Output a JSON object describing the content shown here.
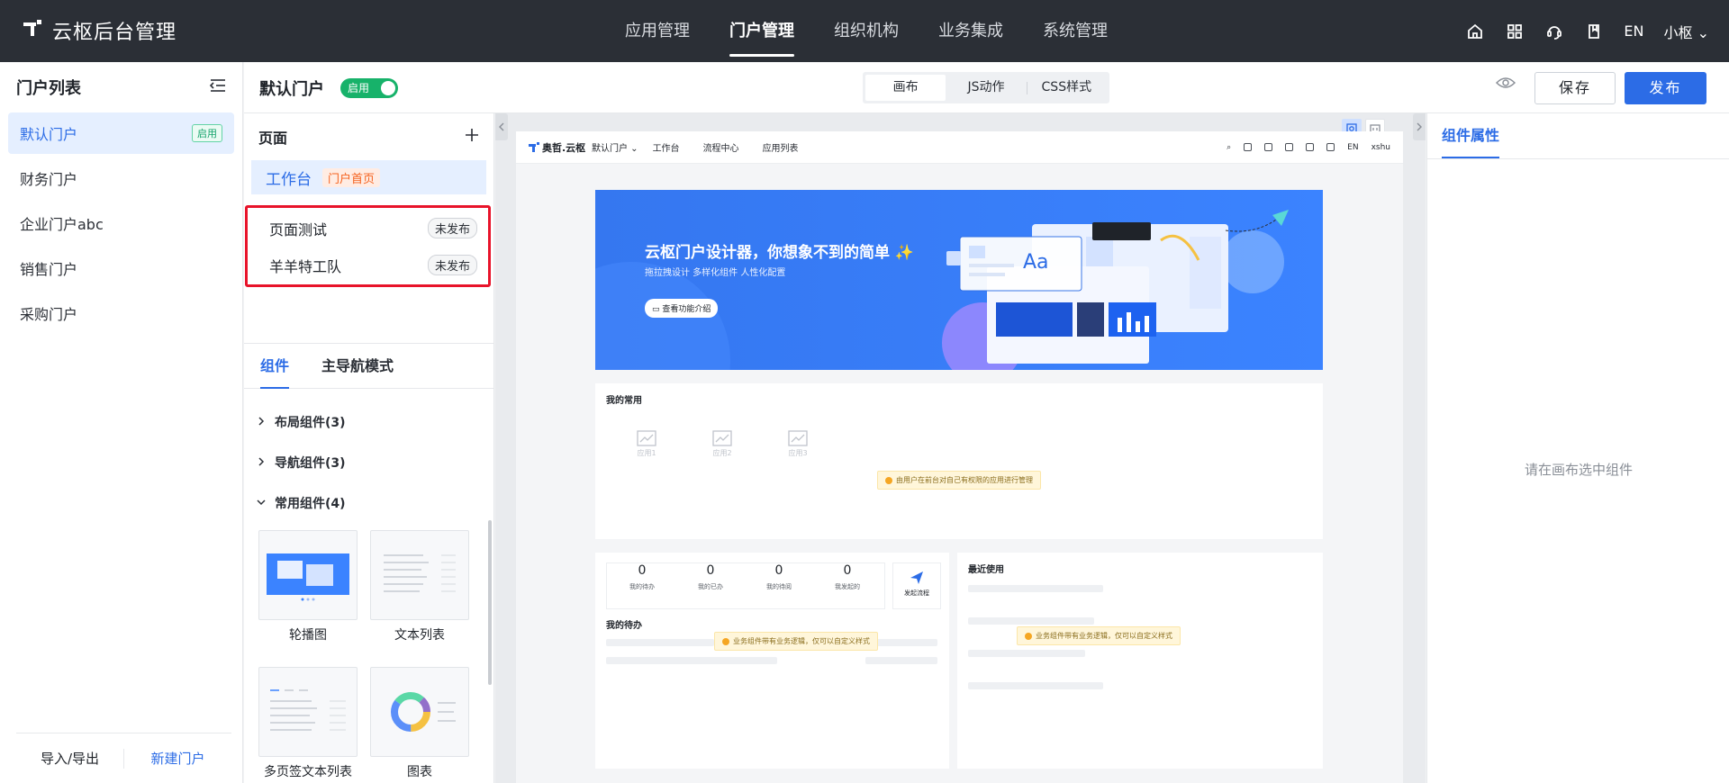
{
  "app": {
    "title": "云枢后台管理"
  },
  "topnav": {
    "items": [
      {
        "label": "应用管理"
      },
      {
        "label": "门户管理",
        "active": true
      },
      {
        "label": "组织机构"
      },
      {
        "label": "业务集成"
      },
      {
        "label": "系统管理"
      }
    ],
    "lang": "EN",
    "user": "小枢"
  },
  "left": {
    "title": "门户列表",
    "items": [
      {
        "label": "默认门户",
        "badge": "启用"
      },
      {
        "label": "财务门户"
      },
      {
        "label": "企业门户abc"
      },
      {
        "label": "销售门户"
      },
      {
        "label": "采购门户"
      }
    ],
    "footer": {
      "import_export": "导入/导出",
      "new_portal": "新建门户"
    }
  },
  "subheader": {
    "title": "默认门户",
    "toggle_label": "启用",
    "tabs": [
      {
        "label": "画布"
      },
      {
        "label": "JS动作"
      },
      {
        "label": "CSS样式"
      }
    ],
    "save": "保存",
    "publish": "发布"
  },
  "pages": {
    "title": "页面",
    "home": {
      "label": "工作台",
      "badge": "门户首页"
    },
    "items": [
      {
        "label": "页面测试",
        "status": "未发布"
      },
      {
        "label": "羊羊特工队",
        "status": "未发布"
      }
    ]
  },
  "components": {
    "tabs": [
      {
        "label": "组件"
      },
      {
        "label": "主导航模式"
      }
    ],
    "groups": [
      {
        "label": "布局组件(3)",
        "expanded": false
      },
      {
        "label": "导航组件(3)",
        "expanded": false
      },
      {
        "label": "常用组件(4)",
        "expanded": true
      }
    ],
    "cards": [
      {
        "label": "轮播图"
      },
      {
        "label": "文本列表"
      },
      {
        "label": "多页签文本列表"
      },
      {
        "label": "图表"
      }
    ]
  },
  "preview": {
    "logo": "奥哲.云枢",
    "portal_select": "默认门户",
    "menu": [
      "工作台",
      "流程中心",
      "应用列表"
    ],
    "right_lang": "EN",
    "right_user": "xshu",
    "banner": {
      "title": "云枢门户设计器，你想象不到的简单 ✨",
      "subtitle": "拖拉拽设计  多样化组件  人性化配置",
      "button": "查看功能介绍",
      "card_text": "Aa"
    },
    "common": {
      "title": "我的常用",
      "apps": [
        "应用1",
        "应用2",
        "应用3"
      ],
      "tip": "由用户在前台对自己有权限的应用进行管理"
    },
    "tasks": {
      "stats": [
        {
          "value": "0",
          "label": "我的待办"
        },
        {
          "value": "0",
          "label": "我的已办"
        },
        {
          "value": "0",
          "label": "我的待阅"
        },
        {
          "value": "0",
          "label": "我发起的"
        }
      ],
      "start": "发起流程",
      "title": "我的待办",
      "tip": "业务组件带有业务逻辑，仅可以自定义样式"
    },
    "recent": {
      "title": "最近使用",
      "tip": "业务组件带有业务逻辑，仅可以自定义样式"
    }
  },
  "properties": {
    "title": "组件属性",
    "empty": "请在画布选中组件"
  },
  "colors": {
    "accent": "#2c6ce6",
    "topbar": "#2b2f36",
    "enabled": "#17b26a",
    "highlight_border": "#e8132a"
  }
}
